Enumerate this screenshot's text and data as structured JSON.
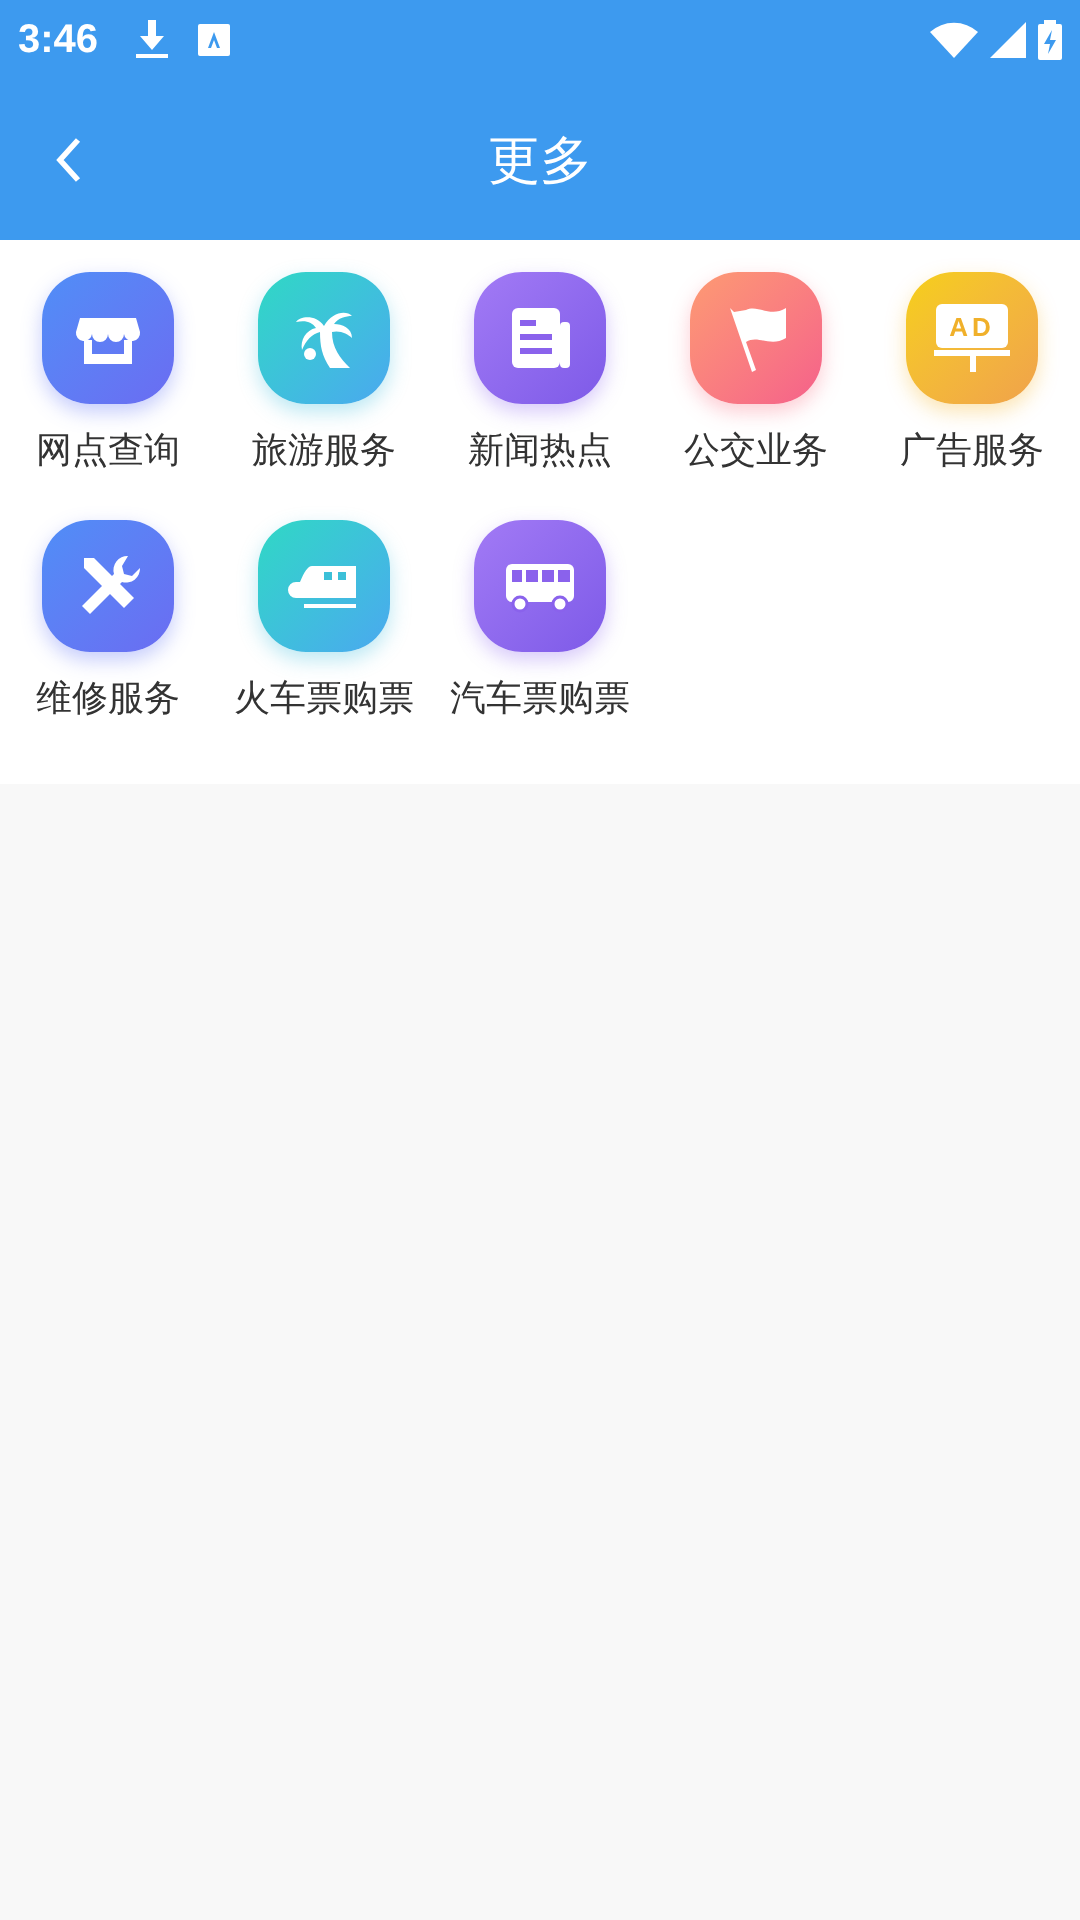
{
  "status_bar": {
    "time": "3:46"
  },
  "header": {
    "title": "更多"
  },
  "items": [
    {
      "label": "网点查询",
      "kind": "store"
    },
    {
      "label": "旅游服务",
      "kind": "palm"
    },
    {
      "label": "新闻热点",
      "kind": "news"
    },
    {
      "label": "公交业务",
      "kind": "flag"
    },
    {
      "label": "广告服务",
      "kind": "billboard",
      "badge": "AD"
    },
    {
      "label": "维修服务",
      "kind": "tools"
    },
    {
      "label": "火车票购票",
      "kind": "train"
    },
    {
      "label": "汽车票购票",
      "kind": "bus"
    }
  ]
}
